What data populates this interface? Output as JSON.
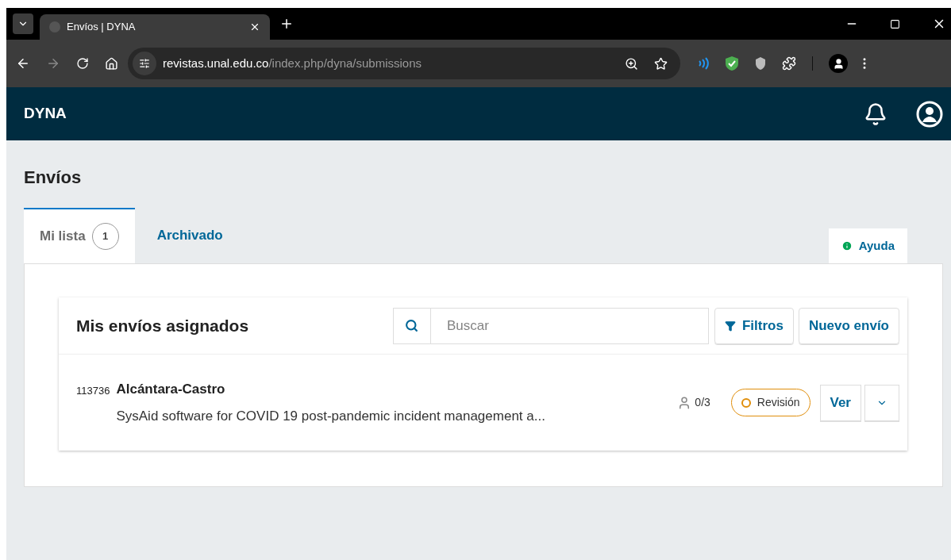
{
  "browser": {
    "tab_title": "Envíos | DYNA",
    "url_host": "revistas.unal.edu.co",
    "url_path": "/index.php/dyna/submissions"
  },
  "header": {
    "title": "DYNA"
  },
  "page_title": "Envíos",
  "tabs": [
    {
      "label": "Mi lista",
      "count": "1",
      "selected": true
    },
    {
      "label": "Archivado",
      "selected": false
    }
  ],
  "help": "Ayuda",
  "panel": {
    "title": "Mis envíos asignados",
    "search": {
      "placeholder": "Buscar"
    },
    "filters": "Filtros",
    "new": "Nuevo envío"
  },
  "submissions": [
    {
      "id": "113736",
      "author": "Alcántara-Castro",
      "title": "SysAid software for COVID 19 post-pandemic incident management a...",
      "reviews": "0/3",
      "stage": "Revisión",
      "view": "Ver"
    }
  ]
}
